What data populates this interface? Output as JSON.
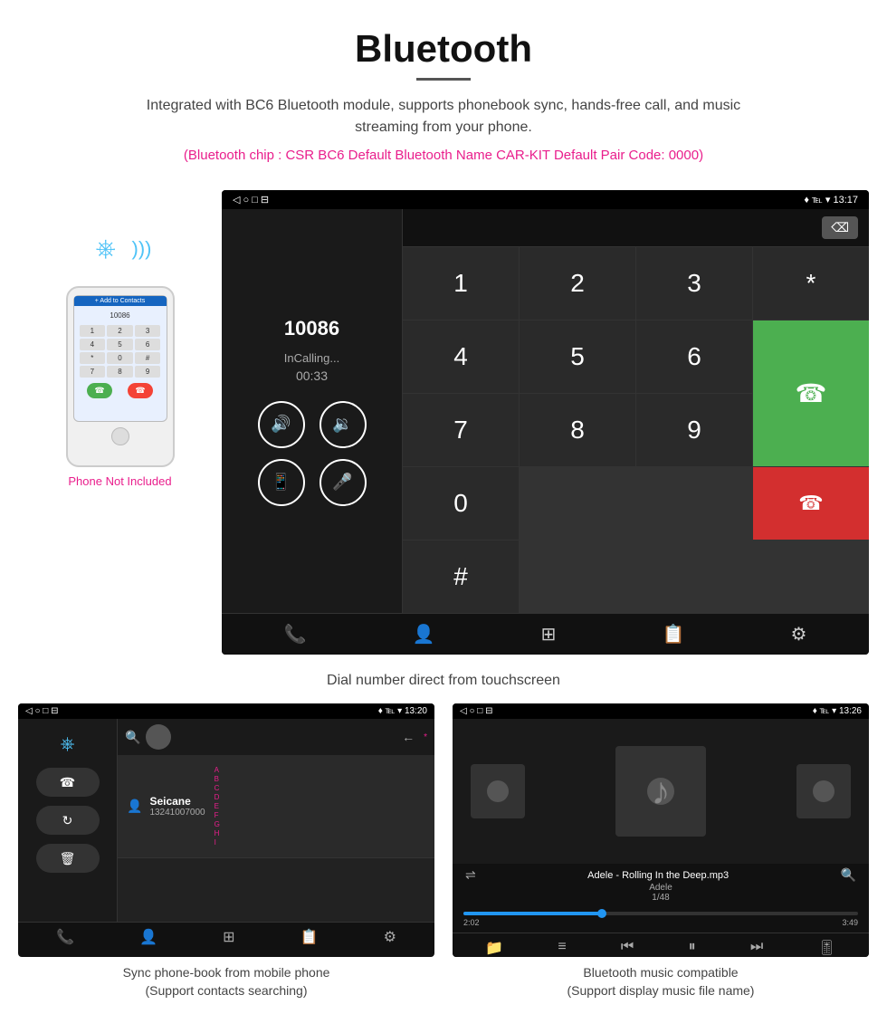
{
  "header": {
    "title": "Bluetooth",
    "description": "Integrated with BC6 Bluetooth module, supports phonebook sync, hands-free call, and music streaming from your phone.",
    "specs": "(Bluetooth chip : CSR BC6    Default Bluetooth Name CAR-KIT    Default Pair Code: 0000)"
  },
  "main_screen": {
    "statusbar": {
      "left": "◁  ○  □  ⊟",
      "right": "♦ ℡ ▾  13:17"
    },
    "call_number": "10086",
    "call_status": "InCalling...",
    "call_timer": "00:33",
    "dialpad_keys": [
      "1",
      "2",
      "3",
      "*",
      "4",
      "5",
      "6",
      "0",
      "7",
      "8",
      "9",
      "#"
    ],
    "caption": "Dial number direct from touchscreen"
  },
  "phonebook_screen": {
    "statusbar_left": "◁  ○  □  ⊟",
    "statusbar_right": "♦ ℡ ▾  13:20",
    "contact_name": "Seicane",
    "contact_number": "13241007000",
    "caption_line1": "Sync phone-book from mobile phone",
    "caption_line2": "(Support contacts searching)"
  },
  "music_screen": {
    "statusbar_left": "◁  ○  □  ⊟",
    "statusbar_right": "♦ ℡ ▾  13:26",
    "song_name": "Adele - Rolling In the Deep.mp3",
    "artist": "Adele",
    "track_info": "1/48",
    "time_current": "2:02",
    "time_total": "3:49",
    "caption_line1": "Bluetooth music compatible",
    "caption_line2": "(Support display music file name)"
  },
  "phone_label": "Phone Not Included",
  "colors": {
    "pink": "#e91e8c",
    "green": "#4caf50",
    "red": "#d32f2f",
    "blue": "#4fc3f7",
    "dark_bg": "#111111"
  }
}
